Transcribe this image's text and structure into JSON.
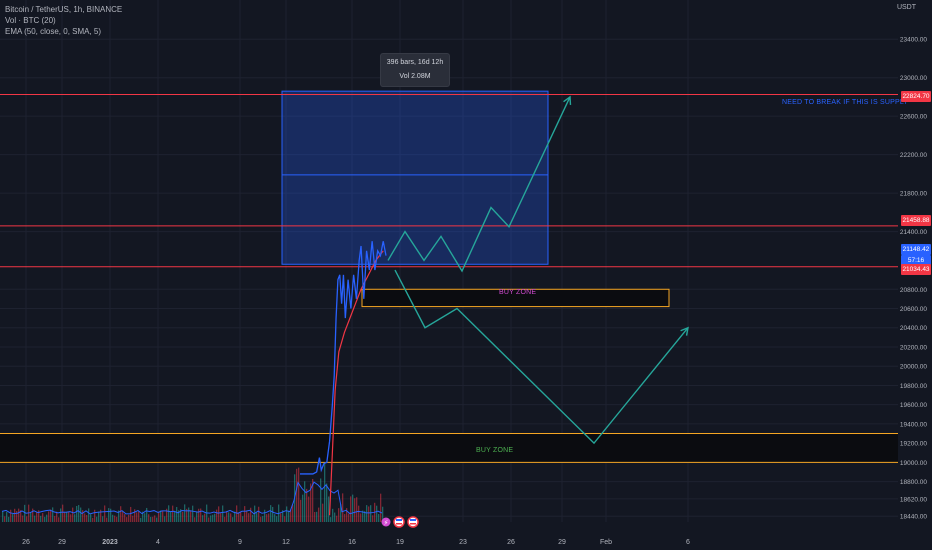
{
  "legend": {
    "symbol": "Bitcoin / TetherUS, 1h, BINANCE",
    "volume": "Vol · BTC (20)",
    "ema": "EMA (50, close, 0, SMA, 5)"
  },
  "axis_unit": "USDT",
  "tooltip": {
    "line1": "396 bars, 16d 12h",
    "line2": "Vol 2.08M"
  },
  "annotations": {
    "supply_text": "NEED TO BREAK IF THIS IS SUPPLY",
    "buy_zone_upper": "BUY ZONE",
    "buy_zone_lower": "BUY ZONE"
  },
  "price_labels": {
    "resistance_high": "22824.70",
    "resistance_mid": "21458.88",
    "current_price": "21148.42",
    "countdown": "57:16",
    "support": "21034.43"
  },
  "colors": {
    "background": "#131722",
    "candle_line": "#2962ff",
    "ema": "#f23645",
    "red_lines": "#f23645",
    "zone_border": "#f5a623",
    "projection": "#26a69a",
    "range_box": "#2962ff",
    "supply_text": "#2962ff",
    "upper_buyzone_text": "#d34bd3",
    "lower_buyzone_text": "#4caf50"
  },
  "chart_data": {
    "type": "line",
    "title": "Bitcoin / TetherUS, 1h, BINANCE",
    "y_ticks": [
      "23400.00",
      "23000.00",
      "22600.00",
      "22200.00",
      "21800.00",
      "21400.00",
      "20800.00",
      "20600.00",
      "20400.00",
      "20200.00",
      "20000.00",
      "19800.00",
      "19600.00",
      "19400.00",
      "19200.00",
      "19000.00",
      "18800.00",
      "18620.00",
      "18440.00"
    ],
    "x_ticks": [
      "26",
      "29",
      "2023",
      "4",
      "9",
      "12",
      "16",
      "19",
      "23",
      "26",
      "29",
      "Feb",
      "6"
    ],
    "ylim": [
      18380,
      23600
    ],
    "price_path": [
      [
        0,
        18880
      ],
      [
        0.7,
        18880
      ],
      [
        0.9,
        18900
      ],
      [
        1.05,
        19050
      ],
      [
        1.15,
        18920
      ],
      [
        1.3,
        18990
      ],
      [
        1.45,
        19000
      ],
      [
        1.6,
        19220
      ],
      [
        1.75,
        19600
      ],
      [
        1.85,
        19900
      ],
      [
        1.95,
        20500
      ],
      [
        2.05,
        20900
      ],
      [
        2.15,
        20950
      ],
      [
        2.25,
        20650
      ],
      [
        2.35,
        20950
      ],
      [
        2.45,
        20500
      ],
      [
        2.6,
        20900
      ],
      [
        2.75,
        20600
      ],
      [
        2.9,
        20950
      ],
      [
        3.05,
        20700
      ],
      [
        3.2,
        21100
      ],
      [
        3.3,
        21250
      ],
      [
        3.45,
        20700
      ],
      [
        3.6,
        21200
      ],
      [
        3.75,
        21000
      ],
      [
        3.9,
        21300
      ],
      [
        4.05,
        21000
      ],
      [
        4.2,
        21200
      ],
      [
        4.35,
        21150
      ],
      [
        4.5,
        21300
      ],
      [
        4.65,
        21150
      ]
    ],
    "ema_path": [
      [
        1.6,
        18450
      ],
      [
        1.75,
        19100
      ],
      [
        1.9,
        19750
      ],
      [
        2.1,
        20150
      ],
      [
        2.4,
        20350
      ],
      [
        2.7,
        20500
      ],
      [
        3.0,
        20650
      ],
      [
        3.3,
        20800
      ],
      [
        3.7,
        20950
      ],
      [
        4.1,
        21100
      ],
      [
        4.5,
        21200
      ]
    ],
    "horizontal_levels": [
      22824.7,
      21458.88,
      21034.43
    ],
    "range_box": {
      "y_top": 22860,
      "y_bottom": 21060,
      "y_mid": 21990,
      "stats": "396 bars, 16d 12h"
    },
    "buy_zones": [
      {
        "label": "BUY ZONE",
        "y_top": 20800,
        "y_bottom": 20620
      },
      {
        "label": "BUY ZONE",
        "y_top": 19300,
        "y_bottom": 19000
      }
    ],
    "projection_bullish": [
      [
        0,
        21100
      ],
      [
        1,
        21400
      ],
      [
        2,
        21100
      ],
      [
        3,
        21350
      ],
      [
        4,
        20990
      ],
      [
        5,
        21650
      ],
      [
        6,
        21450
      ],
      [
        7,
        22800
      ]
    ],
    "projection_bearish": [
      [
        0,
        21000
      ],
      [
        1,
        20400
      ],
      [
        2,
        20600
      ],
      [
        3,
        19200
      ],
      [
        4,
        20400
      ]
    ],
    "grid": true
  }
}
